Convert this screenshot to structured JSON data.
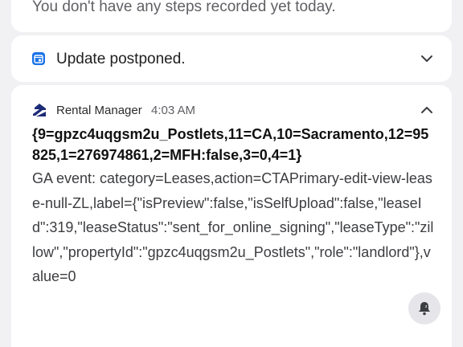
{
  "notifications": [
    {
      "text": "You don't have any steps recorded yet today."
    },
    {
      "title": "Update postponed.",
      "icon": "calendar-clock-icon",
      "accent_color": "#1a73e8",
      "expand_icon": "chevron-down-icon"
    },
    {
      "app_name": "Rental Manager",
      "time": "4:03 AM",
      "app_icon": "zillow-logo-icon",
      "collapse_icon": "chevron-up-icon",
      "title": "{9=gpzc4uqgsm2u_Postlets,11=CA,10=Sacramento,12=95825,1=276974861,2=MFH:false,3=0,4=1}",
      "body": "GA event: category=Leases,action=CTAPrimary-edit-view-lease-null-ZL,label={\"isPreview\":false,\"isSelfUpload\":false,\"leaseId\":319,\"leaseStatus\":\"sent_for_online_signing\",\"leaseType\":\"zillow\",\"propertyId\":\"gpzc4uqgsm2u_Postlets\",\"role\":\"landlord\"},value=0",
      "snooze_icon": "snooze-bell-icon"
    }
  ]
}
